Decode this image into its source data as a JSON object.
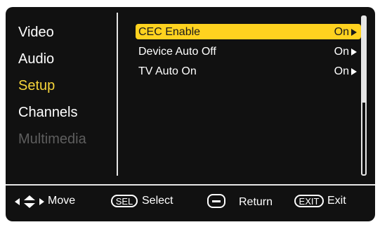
{
  "menu": {
    "items": [
      {
        "label": "Video",
        "state": "normal"
      },
      {
        "label": "Audio",
        "state": "normal"
      },
      {
        "label": "Setup",
        "state": "active"
      },
      {
        "label": "Channels",
        "state": "normal"
      },
      {
        "label": "Multimedia",
        "state": "disabled"
      }
    ]
  },
  "settings": [
    {
      "label": "CEC Enable",
      "value": "On",
      "selected": true
    },
    {
      "label": "Device Auto Off",
      "value": "On",
      "selected": false
    },
    {
      "label": "TV Auto On",
      "value": "On",
      "selected": false
    }
  ],
  "footer": {
    "move_label": "Move",
    "sel_key": "SEL",
    "select_label": "Select",
    "return_label": "Return",
    "exit_key": "EXIT",
    "exit_label": "Exit"
  },
  "colors": {
    "background": "#111111",
    "accent_text": "#f5d43a",
    "highlight_bar": "#ffd21f",
    "disabled_text": "#5e5e5e"
  },
  "icons": {
    "nav": "four-way-arrow-icon",
    "value_arrow": "triangle-right-icon",
    "return": "return-key-icon"
  }
}
